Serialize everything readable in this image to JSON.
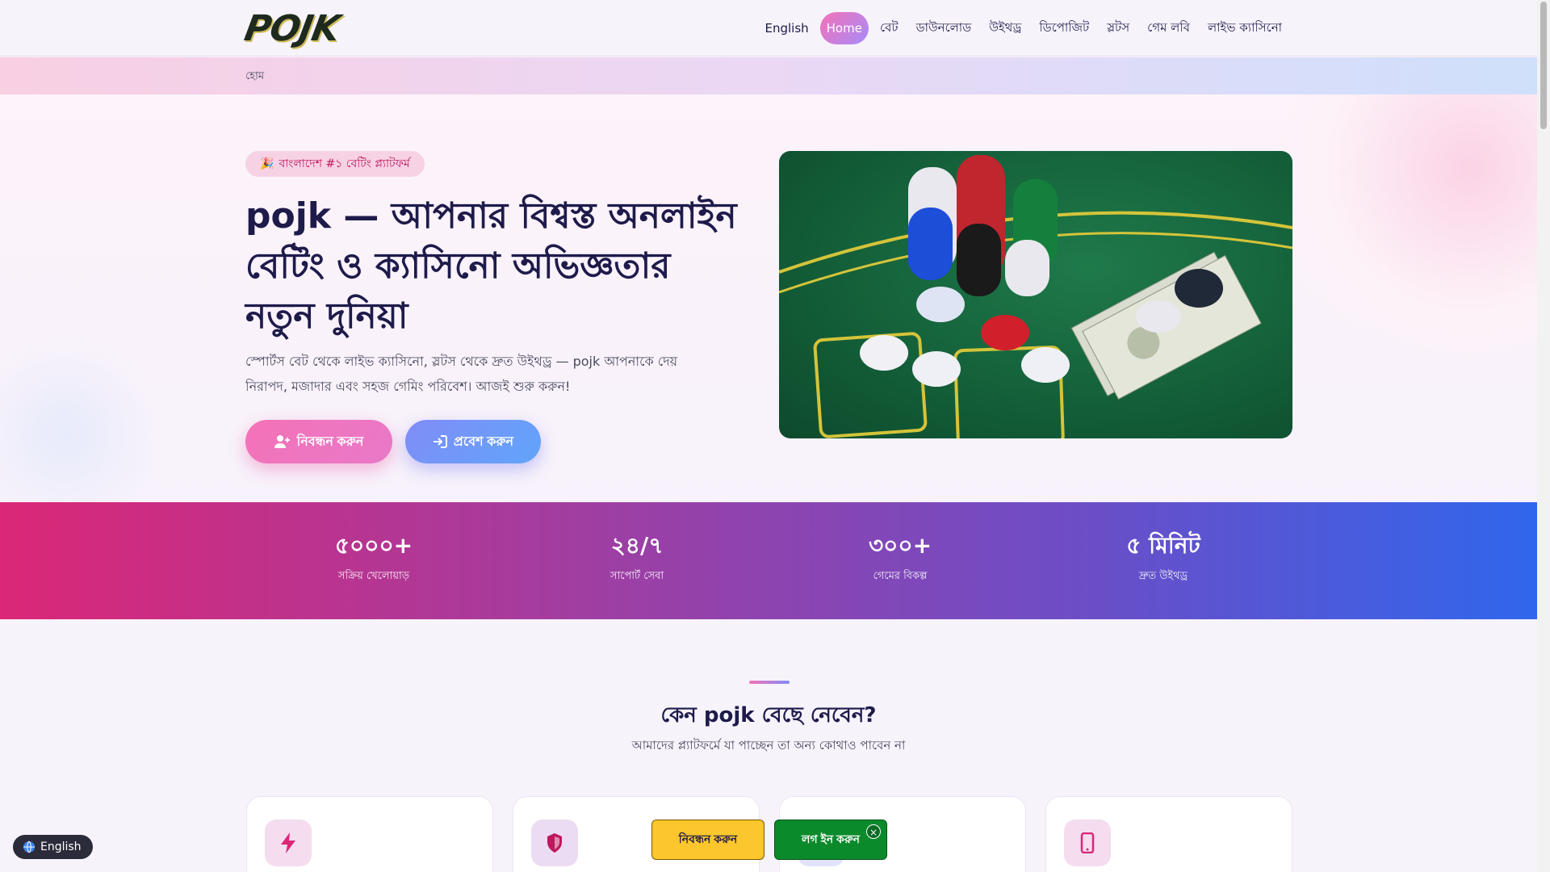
{
  "header": {
    "logo": "POJK",
    "nav": [
      {
        "label": "English"
      },
      {
        "label": "Home",
        "active": true
      },
      {
        "label": "বেট"
      },
      {
        "label": "ডাউনলোড"
      },
      {
        "label": "উইথড্র"
      },
      {
        "label": "ডিপোজিট"
      },
      {
        "label": "স্লটস"
      },
      {
        "label": "গেম লবি"
      },
      {
        "label": "লাইভ ক্যাসিনো"
      }
    ]
  },
  "breadcrumb": "হোম",
  "hero": {
    "badge_icon": "🎉",
    "badge": "বাংলাদেশ #১ বেটিং প্ল্যাটফর্ম",
    "title": "pojk — আপনার বিশ্বস্ত অনলাইন বেটিং ও ক্যাসিনো অভিজ্ঞতার নতুন দুনিয়া",
    "subtitle": "স্পোর্টস বেট থেকে লাইভ ক্যাসিনো, স্লটস থেকে দ্রুত উইথড্র — pojk আপনাকে দেয় নিরাপদ, মজাদার এবং সহজ গেমিং পরিবেশ। আজই শুরু করুন!",
    "register_label": "নিবন্ধন করুন",
    "login_label": "প্রবেশ করুন",
    "image_icon": "casino-chips-table-image"
  },
  "stats": [
    {
      "value": "৫০০০+",
      "label": "সক্রিয় খেলোয়াড়"
    },
    {
      "value": "২৪/৭",
      "label": "সাপোর্ট সেবা"
    },
    {
      "value": "৩০০+",
      "label": "গেমের বিকল্প"
    },
    {
      "value": "৫ মিনিট",
      "label": "দ্রুত উইথড্র"
    }
  ],
  "why": {
    "title": "কেন pojk বেছে নেবেন?",
    "subtitle": "আমাদের প্ল্যাটফর্মে যা পাচ্ছেন তা অন্য কোথাও পাবেন না",
    "cards": [
      {
        "icon": "lightning-icon",
        "color": "#db2777",
        "bg": "#f5dcef"
      },
      {
        "icon": "shield-icon",
        "color": "#be185d",
        "bg": "#ecdcf3"
      },
      {
        "icon": "gift-icon",
        "color": "#6366f1",
        "bg": "#e1e3fb"
      },
      {
        "icon": "mobile-icon",
        "color": "#db2777",
        "bg": "#f5dcef"
      }
    ]
  },
  "floating": {
    "register_label": "নিবন্ধন করুন",
    "login_label": "লগ ইন করুন",
    "close_label": "×",
    "language_label": "English"
  },
  "colors": {
    "accent_pink": "#f472b6",
    "accent_blue": "#818cf8",
    "float_register": "#fcc62d",
    "float_login": "#0b8a2b"
  }
}
